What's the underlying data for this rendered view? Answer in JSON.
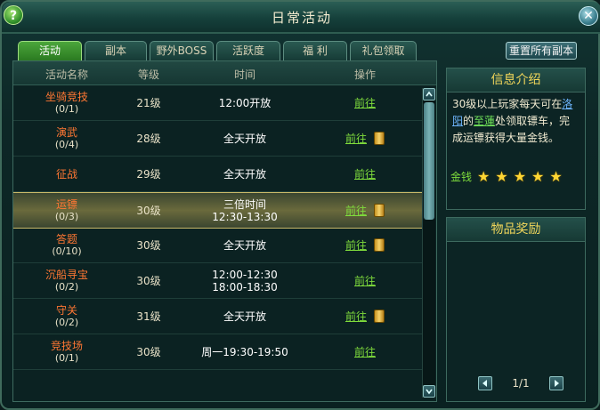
{
  "window": {
    "title": "日常活动"
  },
  "tabs": [
    {
      "label": "活动",
      "active": true
    },
    {
      "label": "副本"
    },
    {
      "label": "野外BOSS"
    },
    {
      "label": "活跃度"
    },
    {
      "label": "福 利"
    },
    {
      "label": "礼包领取"
    }
  ],
  "reset_button": "重置所有副本",
  "table": {
    "headers": [
      "活动名称",
      "等级",
      "时间",
      "操作"
    ],
    "rows": [
      {
        "name": "坐骑竞技",
        "count": "(0/1)",
        "level": "21级",
        "time1": "12:00开放",
        "time2": "",
        "action": "前往",
        "ticket": false
      },
      {
        "name": "演武",
        "count": "(0/4)",
        "level": "28级",
        "time1": "全天开放",
        "time2": "",
        "action": "前往",
        "ticket": true
      },
      {
        "name": "征战",
        "count": "",
        "level": "29级",
        "time1": "全天开放",
        "time2": "",
        "action": "前往",
        "ticket": false
      },
      {
        "name": "运镖",
        "count": "(0/3)",
        "level": "30级",
        "time1": "三倍时间",
        "time2": "12:30-13:30",
        "action": "前往",
        "ticket": true,
        "highlight": true
      },
      {
        "name": "答题",
        "count": "(0/10)",
        "level": "30级",
        "time1": "全天开放",
        "time2": "",
        "action": "前往",
        "ticket": true
      },
      {
        "name": "沉船寻宝",
        "count": "(0/2)",
        "level": "30级",
        "time1": "12:00-12:30",
        "time2": "18:00-18:30",
        "action": "前往",
        "ticket": false
      },
      {
        "name": "守关",
        "count": "(0/2)",
        "level": "31级",
        "time1": "全天开放",
        "time2": "",
        "action": "前往",
        "ticket": true
      },
      {
        "name": "竞技场",
        "count": "(0/1)",
        "level": "30级",
        "time1": "周一19:30-19:50",
        "time2": "",
        "action": "前往",
        "ticket": false
      }
    ]
  },
  "info": {
    "title": "信息介绍",
    "desc_a": "30级以上玩家每天可在",
    "desc_link1": "洛阳",
    "desc_b": "的",
    "desc_link2": "至蓮",
    "desc_c": "处领取镖车，完成运镖获得大量金钱。",
    "money_label": "金钱",
    "stars": 5
  },
  "rewards": {
    "title": "物品奖励",
    "page": "1/1"
  },
  "colors": {
    "accent_green": "#7fdc3c",
    "name_orange": "#ff7733",
    "header_gold": "#f2d75a"
  }
}
